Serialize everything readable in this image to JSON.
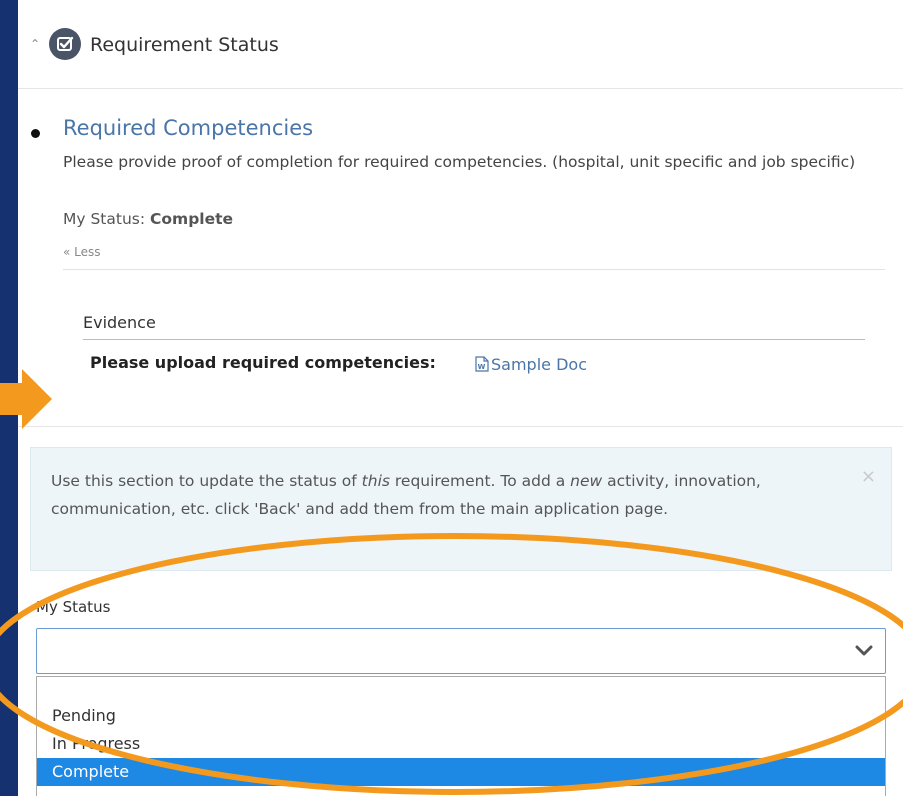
{
  "header": {
    "title": "Requirement Status",
    "collapse_icon": "double-chevron-up-icon",
    "badge_icon": "checkbox-icon"
  },
  "requirement": {
    "title": "Required Competencies",
    "description": "Please provide proof of completion for required competencies. (hospital, unit specific and job specific)",
    "status_label": "My Status:",
    "status_value": "Complete",
    "less_link": "Less"
  },
  "evidence": {
    "heading": "Evidence",
    "upload_label": "Please upload required competencies:",
    "document_name": "Sample Doc",
    "document_icon": "word-document-icon"
  },
  "info_box": {
    "text_part1": "Use this section to update the status of ",
    "text_em1": "this",
    "text_part2": " requirement. To add a ",
    "text_em2": "new",
    "text_part3": " activity, innovation, communication, etc. click 'Back' and add them from the main application page.",
    "close_symbol": "×"
  },
  "status_select": {
    "label": "My Status",
    "selected_value": "",
    "options": [
      "Pending",
      "In Progress",
      "Complete"
    ],
    "highlighted_option": "Complete"
  },
  "colors": {
    "background": "#15316f",
    "link": "#4a75a8",
    "highlight": "#1e88e5",
    "annotation": "#f39a1e"
  }
}
